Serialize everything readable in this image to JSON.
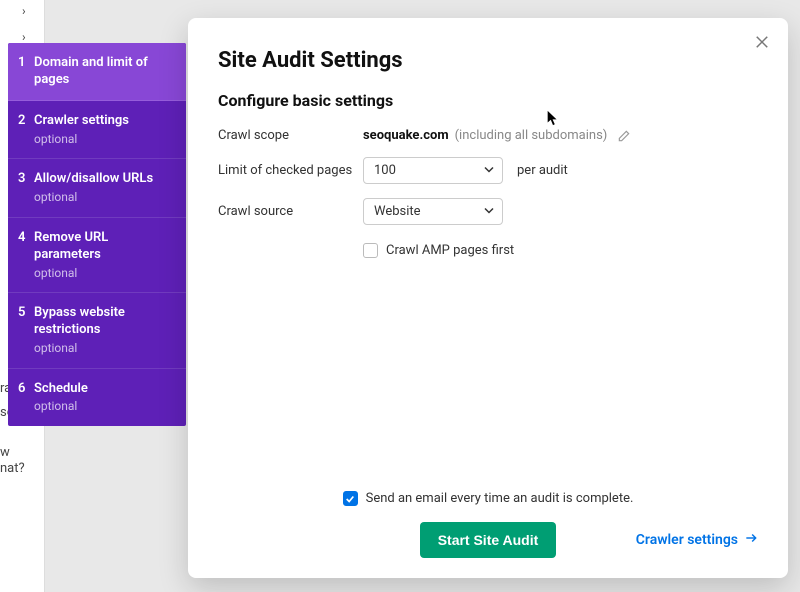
{
  "steps": [
    {
      "num": "1",
      "label": "Domain and limit of pages",
      "optional": null,
      "active": true
    },
    {
      "num": "2",
      "label": "Crawler settings",
      "optional": "optional",
      "active": false
    },
    {
      "num": "3",
      "label": "Allow/disallow URLs",
      "optional": "optional",
      "active": false
    },
    {
      "num": "4",
      "label": "Remove URL parameters",
      "optional": "optional",
      "active": false
    },
    {
      "num": "5",
      "label": "Bypass website restrictions",
      "optional": "optional",
      "active": false
    },
    {
      "num": "6",
      "label": "Schedule",
      "optional": "optional",
      "active": false
    }
  ],
  "header": {
    "title": "Site Audit Settings",
    "subtitle": "Configure basic settings"
  },
  "form": {
    "crawl_scope_label": "Crawl scope",
    "crawl_scope_value": "seoquake.com",
    "crawl_scope_note": "(including all subdomains)",
    "limit_label": "Limit of checked pages",
    "limit_value": "100",
    "limit_suffix": "per audit",
    "source_label": "Crawl source",
    "source_value": "Website",
    "amp_label": "Crawl AMP pages first"
  },
  "footer": {
    "email_label": "Send an email every time an audit is complete.",
    "start_button": "Start Site Audit",
    "next_link": "Crawler settings"
  },
  "background": {
    "text1": "ram",
    "text2": "se or",
    "text3": "w",
    "text4": "nat?"
  }
}
